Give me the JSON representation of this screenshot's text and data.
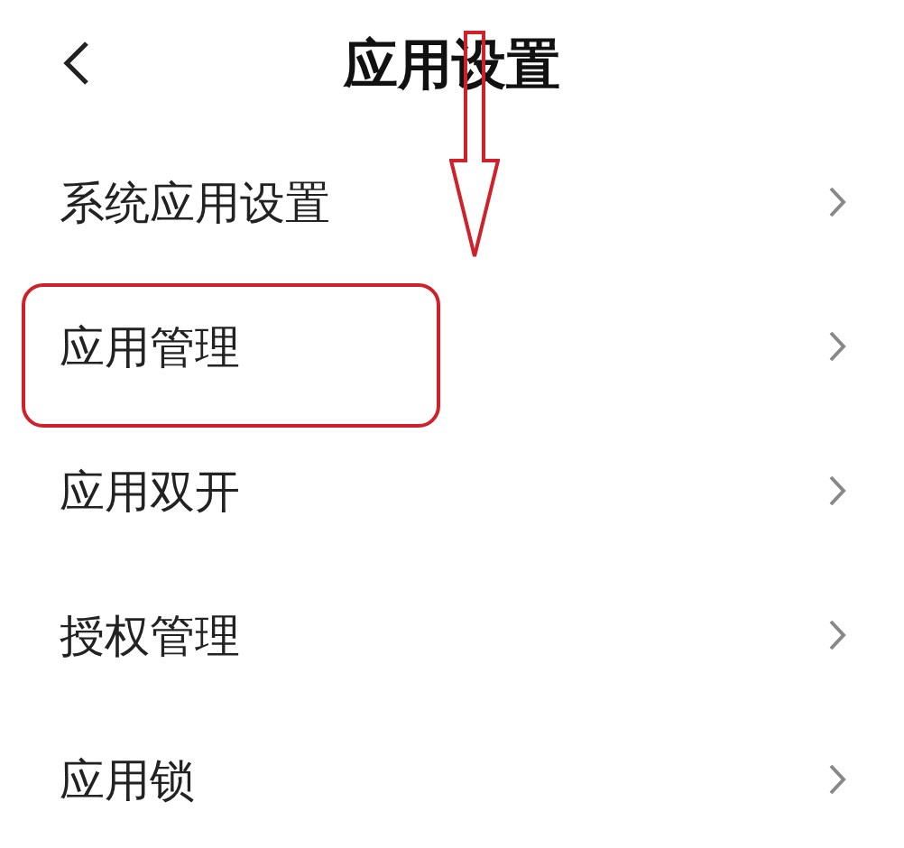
{
  "header": {
    "title": "应用设置"
  },
  "arrow_annotation": true,
  "items": [
    {
      "label": "系统应用设置",
      "highlighted": false
    },
    {
      "label": "应用管理",
      "highlighted": true
    },
    {
      "label": "应用双开",
      "highlighted": false
    },
    {
      "label": "授权管理",
      "highlighted": false
    },
    {
      "label": "应用锁",
      "highlighted": false
    }
  ]
}
